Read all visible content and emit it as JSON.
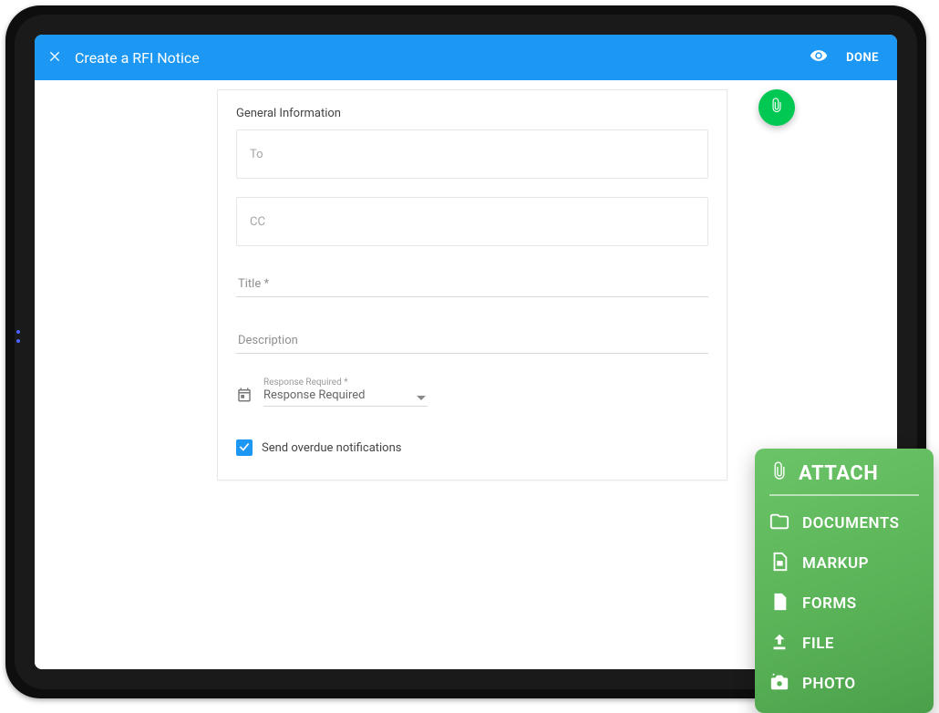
{
  "appbar": {
    "title": "Create a RFI Notice",
    "done_label": "DONE"
  },
  "form": {
    "section_heading": "General Information",
    "to_placeholder": "To",
    "cc_placeholder": "CC",
    "title_label": "Title *",
    "description_label": "Description",
    "response_small_label": "Response Required *",
    "response_value": "Response Required",
    "overdue_label": "Send overdue notifications",
    "overdue_checked": true
  },
  "attach_panel": {
    "header": "ATTACH",
    "items": [
      {
        "icon": "folder-icon",
        "label": "DOCUMENTS"
      },
      {
        "icon": "markup-icon",
        "label": "MARKUP"
      },
      {
        "icon": "forms-icon",
        "label": "FORMS"
      },
      {
        "icon": "upload-icon",
        "label": "FILE"
      },
      {
        "icon": "camera-icon",
        "label": "PHOTO"
      }
    ]
  }
}
